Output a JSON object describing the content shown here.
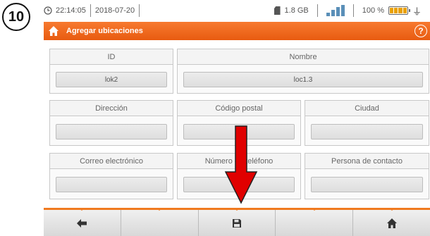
{
  "step": "10",
  "status_bar": {
    "time": "22:14:05",
    "date": "2018-07-20",
    "storage": "1.8 GB",
    "battery_percent": "100 %",
    "signal_level": 4
  },
  "title_bar": {
    "title": "Agregar ubicaciones",
    "help_symbol": "?"
  },
  "form": {
    "id": {
      "label": "ID",
      "value": "lok2"
    },
    "nombre": {
      "label": "Nombre",
      "value": "loc1.3"
    },
    "direccion": {
      "label": "Dirección",
      "value": ""
    },
    "codigo_postal": {
      "label": "Código postal",
      "value": ""
    },
    "ciudad": {
      "label": "Ciudad",
      "value": ""
    },
    "correo": {
      "label": "Correo electrónico",
      "value": ""
    },
    "telefono": {
      "label": "Número de teléfono",
      "value": ""
    },
    "contacto": {
      "label": "Persona de contacto",
      "value": ""
    }
  },
  "toolbar": {
    "buttons": [
      "back-arrow-icon",
      "",
      "save-icon",
      "",
      "home-icon"
    ]
  },
  "colors": {
    "accent_orange": "#f06a1e",
    "annotation_red": "#e00000"
  }
}
